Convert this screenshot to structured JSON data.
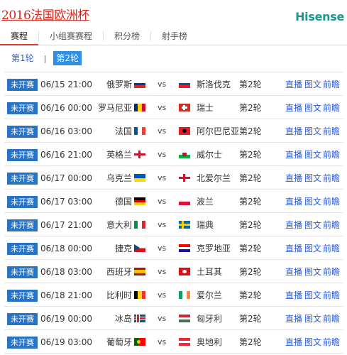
{
  "header": {
    "title": "2016法国欧洲杯",
    "brand": "Hisense"
  },
  "tabs": [
    "赛程",
    "小组赛赛程",
    "积分榜",
    "射手榜"
  ],
  "rounds": {
    "first": "第1轮",
    "separator": "|",
    "second": "第2轮"
  },
  "colors": {
    "accent_red": "#d8291e",
    "status_blue": "#2973c4",
    "link_blue": "#2a5bd7",
    "brand_teal": "#1a9a8f"
  },
  "matches": [
    {
      "status": "未开赛",
      "time": "06/15 21:00",
      "home": "俄罗斯",
      "home_flag": "russia-flag-icon",
      "vs": "vs",
      "away": "斯洛伐克",
      "away_flag": "slovakia-flag-icon",
      "round": "第2轮",
      "links": [
        "直播",
        "图文",
        "前瞻"
      ]
    },
    {
      "status": "未开赛",
      "time": "06/16 00:00",
      "home": "罗马尼亚",
      "home_flag": "romania-flag-icon",
      "vs": "vs",
      "away": "瑞士",
      "away_flag": "switzerland-flag-icon",
      "round": "第2轮",
      "links": [
        "直播",
        "图文",
        "前瞻"
      ]
    },
    {
      "status": "未开赛",
      "time": "06/16 03:00",
      "home": "法国",
      "home_flag": "france-flag-icon",
      "vs": "vs",
      "away": "阿尔巴尼亚",
      "away_flag": "albania-flag-icon",
      "round": "第2轮",
      "links": [
        "直播",
        "图文",
        "前瞻"
      ]
    },
    {
      "status": "未开赛",
      "time": "06/16 21:00",
      "home": "英格兰",
      "home_flag": "england-flag-icon",
      "vs": "vs",
      "away": "威尔士",
      "away_flag": "wales-flag-icon",
      "round": "第2轮",
      "links": [
        "直播",
        "图文",
        "前瞻"
      ]
    },
    {
      "status": "未开赛",
      "time": "06/17 00:00",
      "home": "乌克兰",
      "home_flag": "ukraine-flag-icon",
      "vs": "vs",
      "away": "北爱尔兰",
      "away_flag": "northern-ireland-flag-icon",
      "round": "第2轮",
      "links": [
        "直播",
        "图文",
        "前瞻"
      ]
    },
    {
      "status": "未开赛",
      "time": "06/17 03:00",
      "home": "德国",
      "home_flag": "germany-flag-icon",
      "vs": "vs",
      "away": "波兰",
      "away_flag": "poland-flag-icon",
      "round": "第2轮",
      "links": [
        "直播",
        "图文",
        "前瞻"
      ]
    },
    {
      "status": "未开赛",
      "time": "06/17 21:00",
      "home": "意大利",
      "home_flag": "italy-flag-icon",
      "vs": "vs",
      "away": "瑞典",
      "away_flag": "sweden-flag-icon",
      "round": "第2轮",
      "links": [
        "直播",
        "图文",
        "前瞻"
      ]
    },
    {
      "status": "未开赛",
      "time": "06/18 00:00",
      "home": "捷克",
      "home_flag": "czech-flag-icon",
      "vs": "vs",
      "away": "克罗地亚",
      "away_flag": "croatia-flag-icon",
      "round": "第2轮",
      "links": [
        "直播",
        "图文",
        "前瞻"
      ]
    },
    {
      "status": "未开赛",
      "time": "06/18 03:00",
      "home": "西班牙",
      "home_flag": "spain-flag-icon",
      "vs": "vs",
      "away": "土耳其",
      "away_flag": "turkey-flag-icon",
      "round": "第2轮",
      "links": [
        "直播",
        "图文",
        "前瞻"
      ]
    },
    {
      "status": "未开赛",
      "time": "06/18 21:00",
      "home": "比利时",
      "home_flag": "belgium-flag-icon",
      "vs": "vs",
      "away": "爱尔兰",
      "away_flag": "ireland-flag-icon",
      "round": "第2轮",
      "links": [
        "直播",
        "图文",
        "前瞻"
      ]
    },
    {
      "status": "未开赛",
      "time": "06/19 00:00",
      "home": "冰岛",
      "home_flag": "iceland-flag-icon",
      "vs": "vs",
      "away": "匈牙利",
      "away_flag": "hungary-flag-icon",
      "round": "第2轮",
      "links": [
        "直播",
        "图文",
        "前瞻"
      ]
    },
    {
      "status": "未开赛",
      "time": "06/19 03:00",
      "home": "葡萄牙",
      "home_flag": "portugal-flag-icon",
      "vs": "vs",
      "away": "奥地利",
      "away_flag": "austria-flag-icon",
      "round": "第2轮",
      "links": [
        "直播",
        "图文",
        "前瞻"
      ]
    }
  ]
}
